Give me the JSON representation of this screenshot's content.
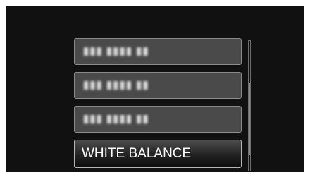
{
  "menu": {
    "items": [
      {
        "label": "▮▮▮ ▮▮▮▮ ▮▮",
        "obscured": true
      },
      {
        "label": "▮▮▮ ▮▮▮▮ ▮▮",
        "obscured": true
      },
      {
        "label": "▮▮▮ ▮▮▮▮ ▮▮",
        "obscured": true
      },
      {
        "label": "WHITE BALANCE",
        "obscured": false,
        "selected": true
      }
    ]
  },
  "scrollbar": {
    "position": 0.72,
    "visible_fraction": 0.55
  },
  "colors": {
    "background": "#111111",
    "item": "#4a4a4a",
    "text": "#ffffff"
  }
}
